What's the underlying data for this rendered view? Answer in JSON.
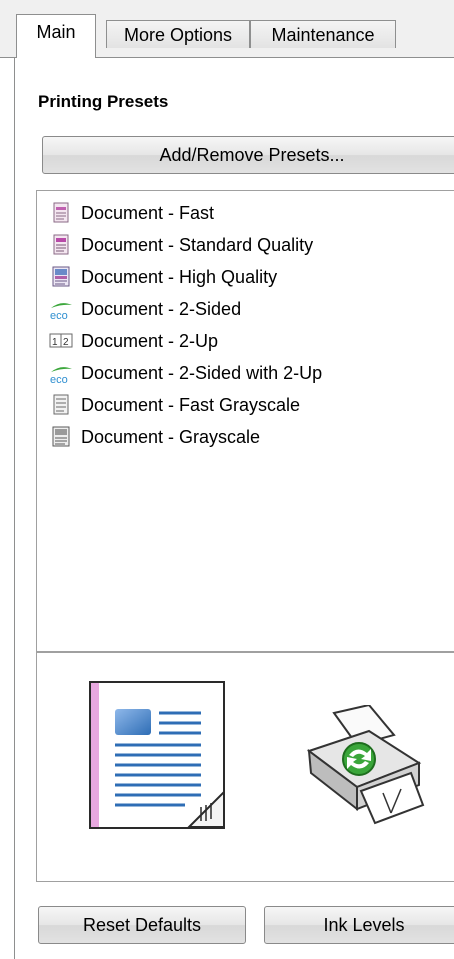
{
  "tabs": [
    {
      "label": "Main"
    },
    {
      "label": "More Options"
    },
    {
      "label": "Maintenance"
    }
  ],
  "section_title": "Printing Presets",
  "add_remove_label": "Add/Remove Presets...",
  "presets": [
    {
      "label": "Document - Fast",
      "icon": "document-fast-icon"
    },
    {
      "label": "Document - Standard Quality",
      "icon": "document-standard-icon"
    },
    {
      "label": "Document - High Quality",
      "icon": "document-high-quality-icon"
    },
    {
      "label": "Document - 2-Sided",
      "icon": "eco-icon"
    },
    {
      "label": "Document - 2-Up",
      "icon": "two-up-icon"
    },
    {
      "label": "Document - 2-Sided with 2-Up",
      "icon": "eco-icon"
    },
    {
      "label": "Document - Fast Grayscale",
      "icon": "document-grayscale-fast-icon"
    },
    {
      "label": "Document - Grayscale",
      "icon": "document-grayscale-icon"
    }
  ],
  "two_up_icon_digits": [
    "1",
    "2"
  ],
  "eco_icon_text": "eco",
  "reset_defaults_label": "Reset Defaults",
  "ink_levels_label": "Ink Levels",
  "colors": {
    "eco_green": "#3aa63a",
    "page_pink": "#e8a8e0",
    "page_blue": "#2e6db5"
  }
}
